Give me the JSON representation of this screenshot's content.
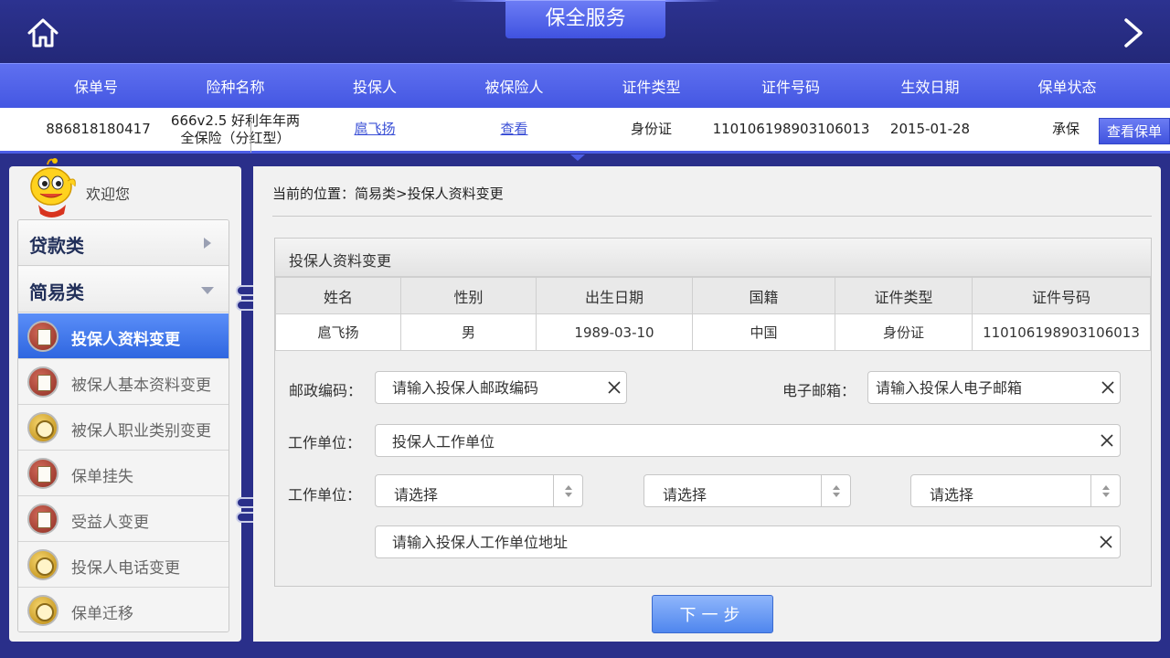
{
  "header": {
    "title": "保全服务",
    "home_icon": "home-icon",
    "next_icon": "chevron-right-icon"
  },
  "policy": {
    "columns": [
      "保单号",
      "险种名称",
      "投保人",
      "被保险人",
      "证件类型",
      "证件号码",
      "生效日期",
      "保单状态"
    ],
    "row": {
      "policy_no": "886818180417",
      "product_line1": "666v2.5 好利年年两",
      "product_line2": "全保险（分红型）",
      "applicant": "扈飞扬",
      "insured": "查看",
      "id_type": "身份证",
      "id_no": "110106198903106013",
      "effective_date": "2015-01-28",
      "status": "承保"
    },
    "view_button": "查看保单"
  },
  "sidebar": {
    "welcome": "欢迎您",
    "categories": [
      {
        "label": "贷款类",
        "expanded": false
      },
      {
        "label": "简易类",
        "expanded": true
      }
    ],
    "items": [
      {
        "label": "投保人资料变更",
        "active": true,
        "icon": "notepad-icon"
      },
      {
        "label": "被保人基本资料变更",
        "active": false,
        "icon": "news-icon"
      },
      {
        "label": "被保人职业类别变更",
        "active": false,
        "icon": "clock-icon"
      },
      {
        "label": "保单挂失",
        "active": false,
        "icon": "notepad-icon"
      },
      {
        "label": "受益人变更",
        "active": false,
        "icon": "news-icon"
      },
      {
        "label": "投保人电话变更",
        "active": false,
        "icon": "clock-icon"
      },
      {
        "label": "保单迁移",
        "active": false,
        "icon": "clock-icon"
      }
    ]
  },
  "main": {
    "breadcrumb": "当前的位置：简易类>投保人资料变更",
    "form_title": "投保人资料变更",
    "table": {
      "headers": [
        "姓名",
        "性别",
        "出生日期",
        "国籍",
        "证件类型",
        "证件号码"
      ],
      "row": [
        "扈飞扬",
        "男",
        "1989-03-10",
        "中国",
        "身份证",
        "110106198903106013"
      ]
    },
    "fields": {
      "postal_label": "邮政编码：",
      "postal_placeholder": "请输入投保人邮政编码",
      "email_label": "电子邮箱：",
      "email_placeholder": "请输入投保人电子邮箱",
      "work_unit_label": "工作单位：",
      "work_unit_value": "投保人工作单位",
      "work_addr_label": "工作单位：",
      "select1": "请选择",
      "select2": "请选择",
      "select3": "请选择",
      "address_placeholder": "请输入投保人工作单位地址"
    },
    "next_button": "下一步"
  }
}
